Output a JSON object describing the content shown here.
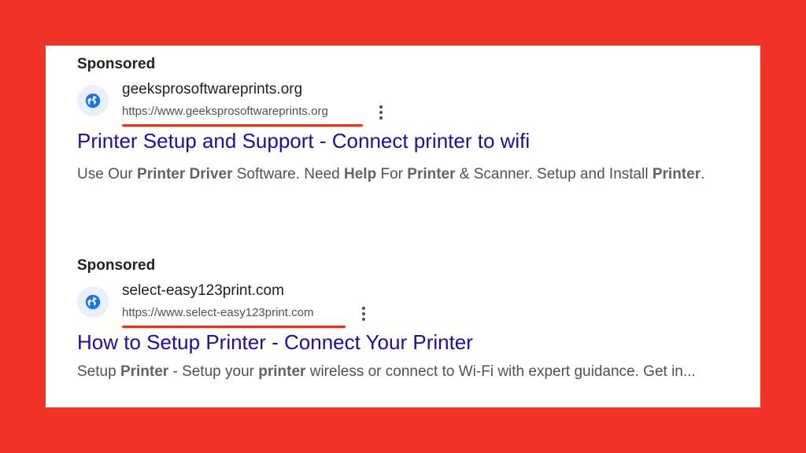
{
  "ads": [
    {
      "sponsored_label": "Sponsored",
      "site_name": "geeksprosoftwareprints.org",
      "url": "https://www.geeksprosoftwareprints.org",
      "title": "Printer Setup and Support - Connect printer to wifi",
      "description": [
        {
          "text": "Use Our ",
          "bold": false
        },
        {
          "text": "Printer Driver",
          "bold": true
        },
        {
          "text": " Software. Need ",
          "bold": false
        },
        {
          "text": "Help",
          "bold": true
        },
        {
          "text": " For ",
          "bold": false
        },
        {
          "text": "Printer",
          "bold": true
        },
        {
          "text": " & Scanner. Setup and Install ",
          "bold": false
        },
        {
          "text": "Printer",
          "bold": true
        },
        {
          "text": ".",
          "bold": false
        }
      ]
    },
    {
      "sponsored_label": "Sponsored",
      "site_name": "select-easy123print.com",
      "url": "https://www.select-easy123print.com",
      "title": "How to Setup Printer - Connect Your Printer",
      "description": [
        {
          "text": "Setup ",
          "bold": false
        },
        {
          "text": "Printer",
          "bold": true
        },
        {
          "text": " - Setup your ",
          "bold": false
        },
        {
          "text": "printer",
          "bold": true
        },
        {
          "text": " wireless or connect to Wi-Fi with expert guidance. Get in...",
          "bold": false
        }
      ]
    }
  ],
  "icons": {
    "favicon": "globe-icon",
    "more": "more-vertical-icon"
  },
  "colors": {
    "background": "#ef3327",
    "card": "#ffffff",
    "link": "#1a0dab",
    "underline": "#e8321f",
    "favicon_bg": "#e8f0fe",
    "globe": "#1a73e8"
  }
}
